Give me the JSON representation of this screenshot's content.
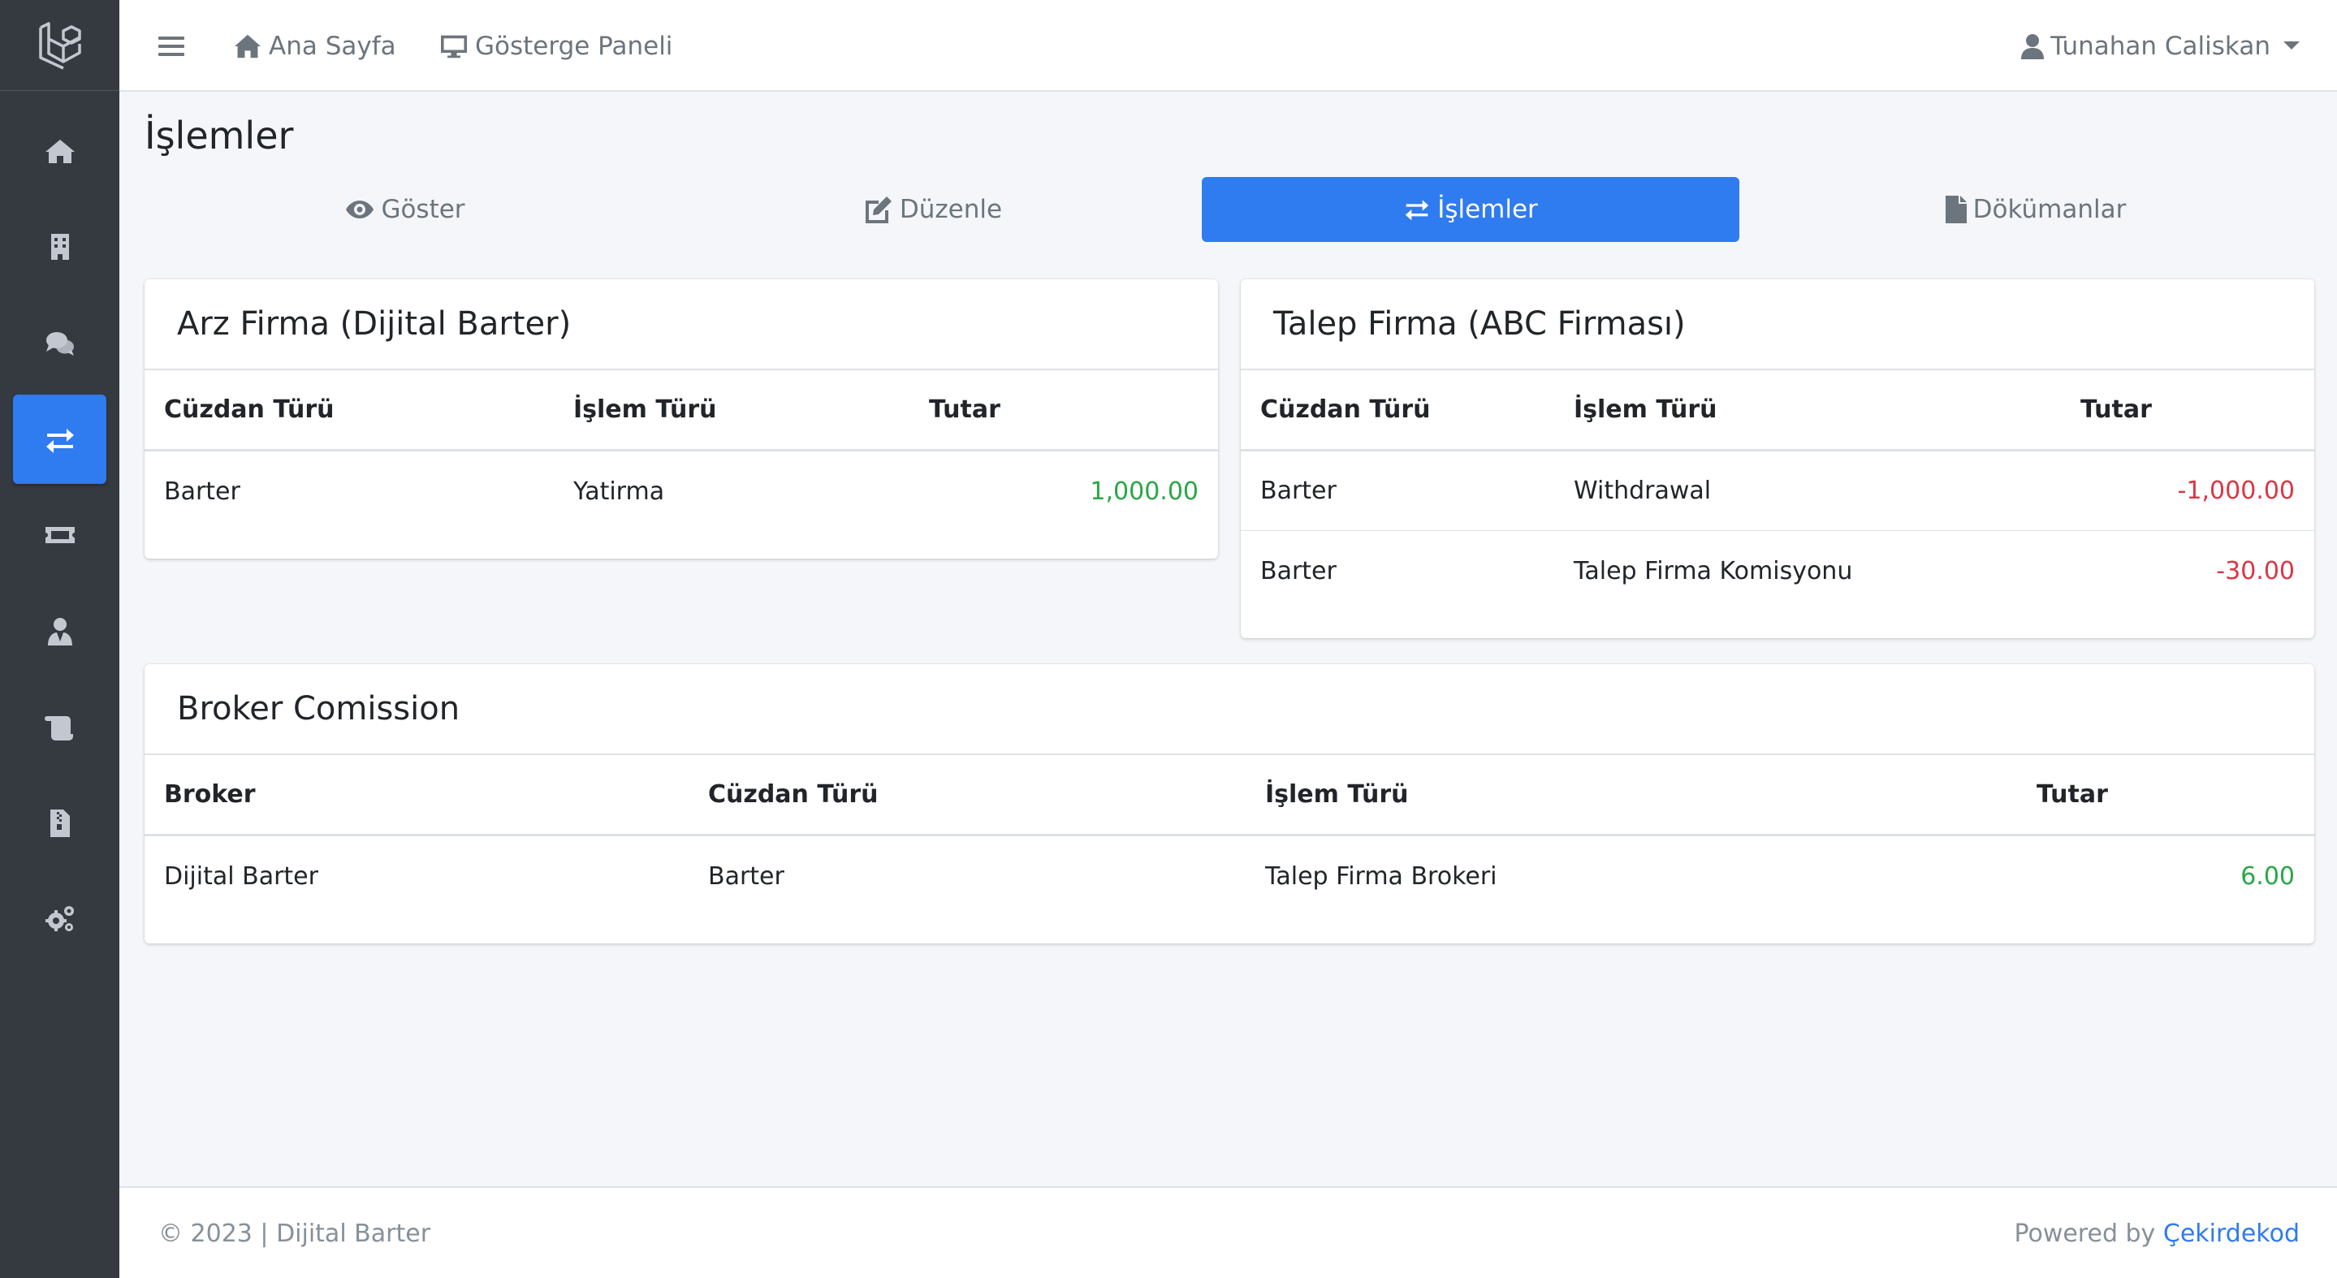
{
  "topbar": {
    "home_label": "Ana Sayfa",
    "dashboard_label": "Gösterge Paneli",
    "user_name": "Tunahan Caliskan"
  },
  "page": {
    "title": "İşlemler"
  },
  "tabs": [
    {
      "label": "Göster",
      "icon": "eye-icon",
      "active": false
    },
    {
      "label": "Düzenle",
      "icon": "edit-icon",
      "active": false
    },
    {
      "label": "İşlemler",
      "icon": "exchange-icon",
      "active": true
    },
    {
      "label": "Dökümanlar",
      "icon": "file-icon",
      "active": false
    }
  ],
  "sidebar": {
    "items": [
      {
        "icon": "home-icon",
        "active": false
      },
      {
        "icon": "building-icon",
        "active": false
      },
      {
        "icon": "comments-icon",
        "active": false
      },
      {
        "icon": "exchange-icon",
        "active": true
      },
      {
        "icon": "ticket-icon",
        "active": false
      },
      {
        "icon": "user-tie-icon",
        "active": false
      },
      {
        "icon": "scroll-icon",
        "active": false
      },
      {
        "icon": "file-archive-icon",
        "active": false
      },
      {
        "icon": "cogs-icon",
        "active": false
      }
    ]
  },
  "arz_card": {
    "title": "Arz Firma (Dijital Barter)",
    "headers": [
      "Cüzdan Türü",
      "İşlem Türü",
      "Tutar"
    ],
    "rows": [
      [
        "Barter",
        "Yatirma",
        "1,000.00"
      ]
    ]
  },
  "talep_card": {
    "title": "Talep Firma (ABC Firması)",
    "headers": [
      "Cüzdan Türü",
      "İşlem Türü",
      "Tutar"
    ],
    "rows": [
      [
        "Barter",
        "Withdrawal",
        "-1,000.00"
      ],
      [
        "Barter",
        "Talep Firma Komisyonu",
        "-30.00"
      ]
    ]
  },
  "broker_card": {
    "title": "Broker Comission",
    "headers": [
      "Broker",
      "Cüzdan Türü",
      "İşlem Türü",
      "Tutar"
    ],
    "rows": [
      [
        "Dijital Barter",
        "Barter",
        "Talep Firma Brokeri",
        "6.00"
      ]
    ]
  },
  "footer": {
    "copyright": "© 2023 | Dijital Barter",
    "powered_by": "Powered by",
    "company": "Çekirdekod"
  },
  "colors": {
    "accent": "#2f7bf0",
    "sidebar_bg": "#343a40",
    "positive": "#28a745",
    "negative": "#dc3545"
  }
}
